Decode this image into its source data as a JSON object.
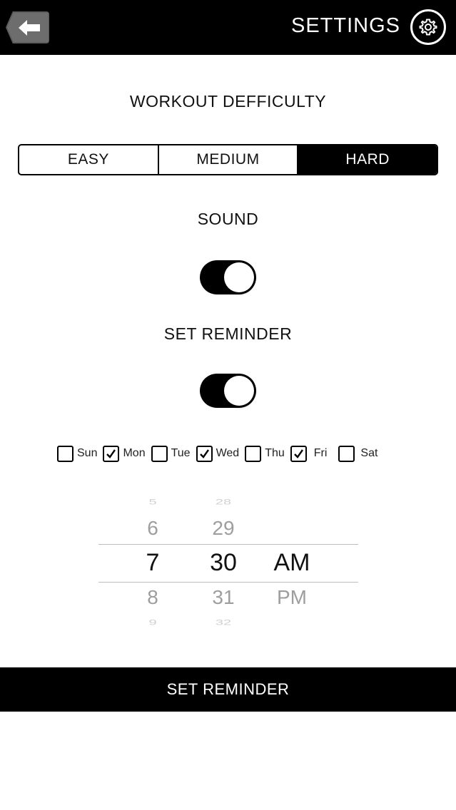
{
  "header": {
    "title": "SETTINGS",
    "back_icon": "arrow-left-icon",
    "settings_icon": "gear-icon"
  },
  "difficulty": {
    "title": "WORKOUT DEFFICULTY",
    "options": [
      "EASY",
      "MEDIUM",
      "HARD"
    ],
    "selected": "HARD"
  },
  "sound": {
    "title": "SOUND",
    "on": true
  },
  "reminder": {
    "title": "SET REMINDER",
    "on": true,
    "days": [
      {
        "label": "Sun",
        "checked": false
      },
      {
        "label": "Mon",
        "checked": true
      },
      {
        "label": "Tue",
        "checked": false
      },
      {
        "label": "Wed",
        "checked": true
      },
      {
        "label": "Thu",
        "checked": false
      },
      {
        "label": "Fri",
        "checked": true
      },
      {
        "label": "Sat",
        "checked": false
      }
    ],
    "time_picker": {
      "hours": [
        "5",
        "6",
        "7",
        "8",
        "9"
      ],
      "minutes": [
        "28",
        "29",
        "30",
        "31",
        "32"
      ],
      "periods": [
        "AM",
        "PM"
      ],
      "selected_hour": "7",
      "selected_minute": "30",
      "selected_period": "AM"
    },
    "button_label": "SET REMINDER"
  },
  "colors": {
    "primary": "#000000",
    "background": "#ffffff",
    "muted": "#9e9e9e"
  }
}
